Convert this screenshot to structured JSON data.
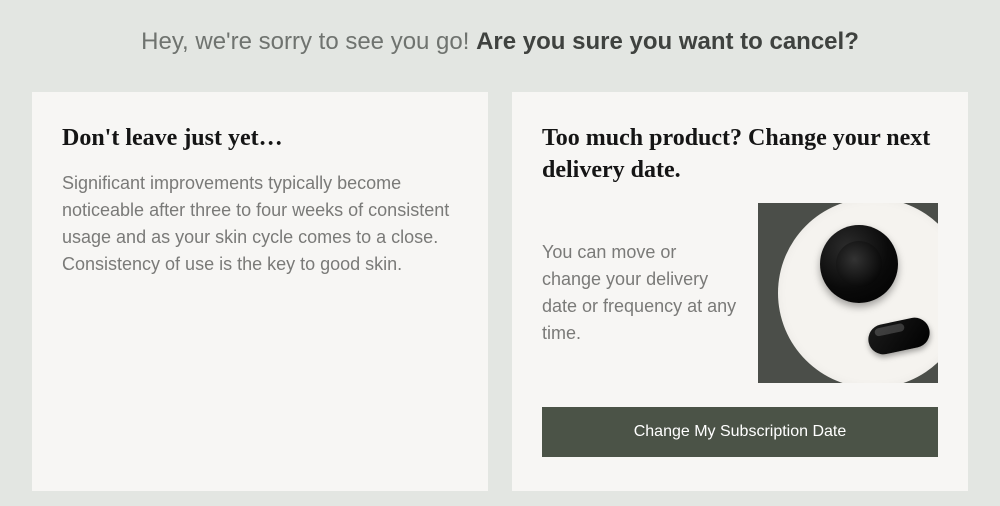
{
  "header": {
    "light": "Hey, we're sorry to see you go! ",
    "bold": "Are you sure you want to cancel?"
  },
  "left_card": {
    "title": "Don't leave just yet…",
    "body": "Significant improvements typically become noticeable after three to four weeks of consistent usage and as your skin cycle comes to a close. Consistency of use is the key to good skin."
  },
  "right_card": {
    "title": "Too much product? Change your next delivery date.",
    "body": "You can move or change your delivery date or frequency at any time.",
    "cta_label": "Change My Subscription Date",
    "image_alt": "product-jar-on-plate"
  }
}
